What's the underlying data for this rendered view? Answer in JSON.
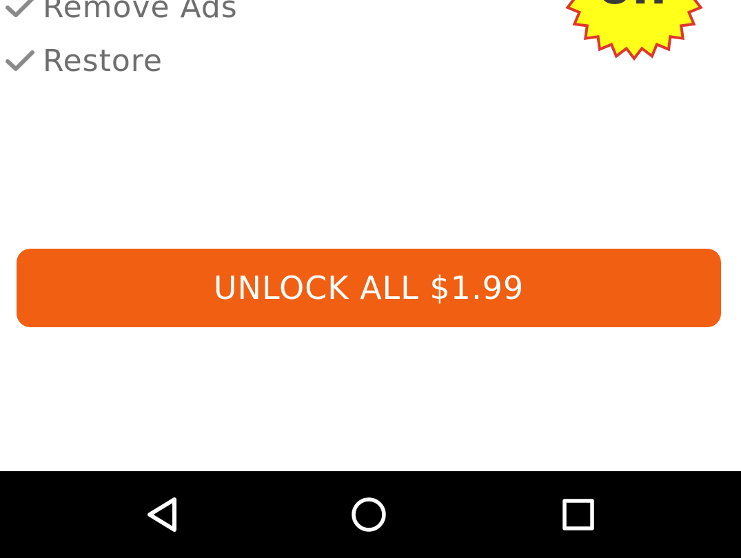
{
  "features": {
    "items": [
      {
        "label": "Remove Ads",
        "icon": "checkmark-icon"
      },
      {
        "label": "Restore",
        "icon": "checkmark-icon"
      }
    ]
  },
  "badge": {
    "text": "off",
    "color": "#ffff1a",
    "border_color": "#e0362b"
  },
  "purchase": {
    "button_label": "UNLOCK ALL $1.99",
    "button_color": "#f15f12"
  },
  "navigation_bar": {
    "buttons": [
      {
        "name": "back",
        "icon": "back-triangle-icon"
      },
      {
        "name": "home",
        "icon": "home-circle-icon"
      },
      {
        "name": "recents",
        "icon": "recents-square-icon"
      }
    ],
    "background": "#000000"
  }
}
